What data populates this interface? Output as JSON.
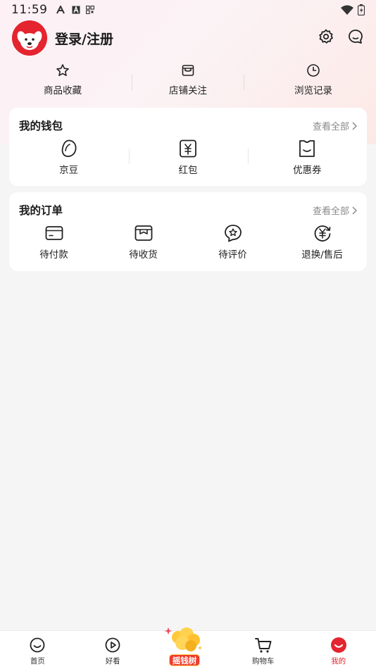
{
  "status_bar": {
    "time": "11:59",
    "icons": [
      "A",
      "A",
      "QR"
    ]
  },
  "profile": {
    "login_label": "登录/注册"
  },
  "quick_links": [
    {
      "label": "商品收藏",
      "icon": "star-icon"
    },
    {
      "label": "店铺关注",
      "icon": "store-icon"
    },
    {
      "label": "浏览记录",
      "icon": "clock-icon"
    }
  ],
  "wallet": {
    "title": "我的钱包",
    "more": "查看全部",
    "items": [
      {
        "label": "京豆",
        "icon": "bean-icon"
      },
      {
        "label": "红包",
        "icon": "red-envelope-icon"
      },
      {
        "label": "优惠券",
        "icon": "coupon-icon"
      }
    ]
  },
  "orders": {
    "title": "我的订单",
    "more": "查看全部",
    "items": [
      {
        "label": "待付款",
        "icon": "card-icon"
      },
      {
        "label": "待收货",
        "icon": "package-icon"
      },
      {
        "label": "待评价",
        "icon": "review-icon"
      },
      {
        "label": "退换/售后",
        "icon": "refund-icon"
      }
    ]
  },
  "tabbar": {
    "items": [
      {
        "label": "首页",
        "icon": "home-icon"
      },
      {
        "label": "好看",
        "icon": "play-icon"
      },
      {
        "label": "摇钱树",
        "icon": "money-tree-icon"
      },
      {
        "label": "购物车",
        "icon": "cart-icon"
      },
      {
        "label": "我的",
        "icon": "me-icon",
        "active": true
      }
    ]
  },
  "colors": {
    "accent": "#e4242e",
    "muted": "#8a8a8a",
    "background": "#f5f5f5"
  }
}
